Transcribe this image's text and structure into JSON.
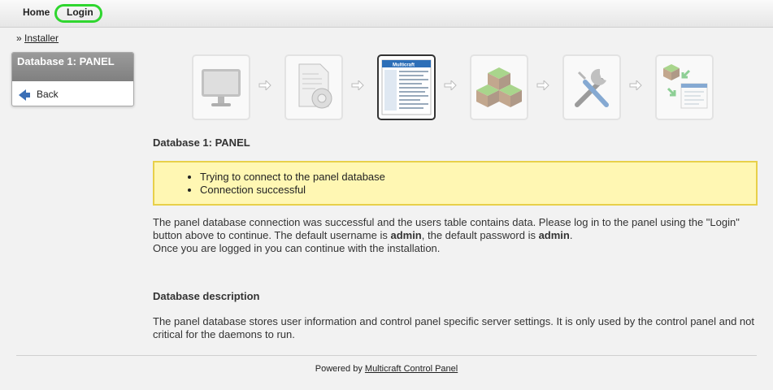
{
  "nav": {
    "home_label": "Home",
    "login_label": "Login",
    "highlight_color": "#2fd62f"
  },
  "breadcrumb": {
    "prefix": "»",
    "link_label": "Installer"
  },
  "sidebar": {
    "title": "Database 1: PANEL",
    "back_label": "Back"
  },
  "steps": {
    "icons": [
      "monitor-icon",
      "document-gear-icon",
      "multicraft-screenshot-icon",
      "grass-blocks-icon",
      "tools-icon",
      "blocks-transfer-icon"
    ],
    "active_index": 2,
    "active_thumb_label": "Multicraft"
  },
  "content": {
    "title": "Database 1: PANEL",
    "notice_items": [
      "Trying to connect to the panel database",
      "Connection successful"
    ],
    "p1_a": "The panel database connection was successful and the users table contains data. Please log in to the panel using the \"Login\" button above to continue. The default username is ",
    "p1_user": "admin",
    "p1_b": ", the default password is ",
    "p1_pass": "admin",
    "p1_c": ".",
    "p1_line2": "Once you are logged in you can continue with the installation.",
    "desc_title": "Database description",
    "desc_text": "The panel database stores user information and control panel specific server settings. It is only used by the control panel and not critical for the daemons to run."
  },
  "footer": {
    "prefix": "Powered by",
    "link_label": "Multicraft Control Panel"
  }
}
